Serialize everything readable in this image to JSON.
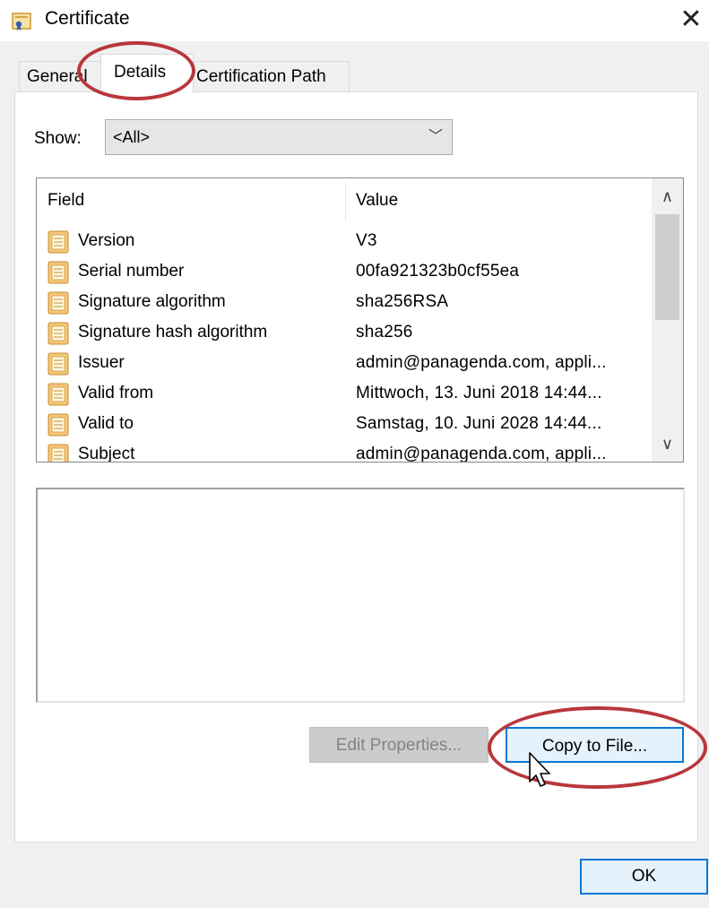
{
  "window": {
    "title": "Certificate",
    "close_glyph": "✕"
  },
  "tabs": [
    {
      "label": "General",
      "active": false
    },
    {
      "label": "Details",
      "active": true
    },
    {
      "label": "Certification Path",
      "active": false
    }
  ],
  "show": {
    "label": "Show:",
    "selected": "<All>",
    "chevron": "﹀"
  },
  "list": {
    "columns": {
      "field": "Field",
      "value": "Value"
    },
    "rows": [
      {
        "field": "Version",
        "value": "V3"
      },
      {
        "field": "Serial number",
        "value": "00fa921323b0cf55ea"
      },
      {
        "field": "Signature algorithm",
        "value": "sha256RSA"
      },
      {
        "field": "Signature hash algorithm",
        "value": "sha256"
      },
      {
        "field": "Issuer",
        "value": "admin@panagenda.com, appli..."
      },
      {
        "field": "Valid from",
        "value": "Mittwoch, 13. Juni 2018 14:44..."
      },
      {
        "field": "Valid to",
        "value": "Samstag, 10. Juni 2028 14:44..."
      },
      {
        "field": "Subject",
        "value": "admin@panagenda.com, appli..."
      }
    ],
    "scroll_up": "∧",
    "scroll_down": "∨"
  },
  "detail_text": "",
  "buttons": {
    "edit_properties": "Edit Properties...",
    "copy_to_file": "Copy to File...",
    "ok": "OK"
  },
  "colors": {
    "accent": "#0078d7",
    "annotation": "#b8373b",
    "icon": "#e8b85a"
  },
  "icons": {
    "title": "certificate-icon",
    "row": "certificate-field-icon",
    "cursor": "mouse-pointer-icon"
  }
}
